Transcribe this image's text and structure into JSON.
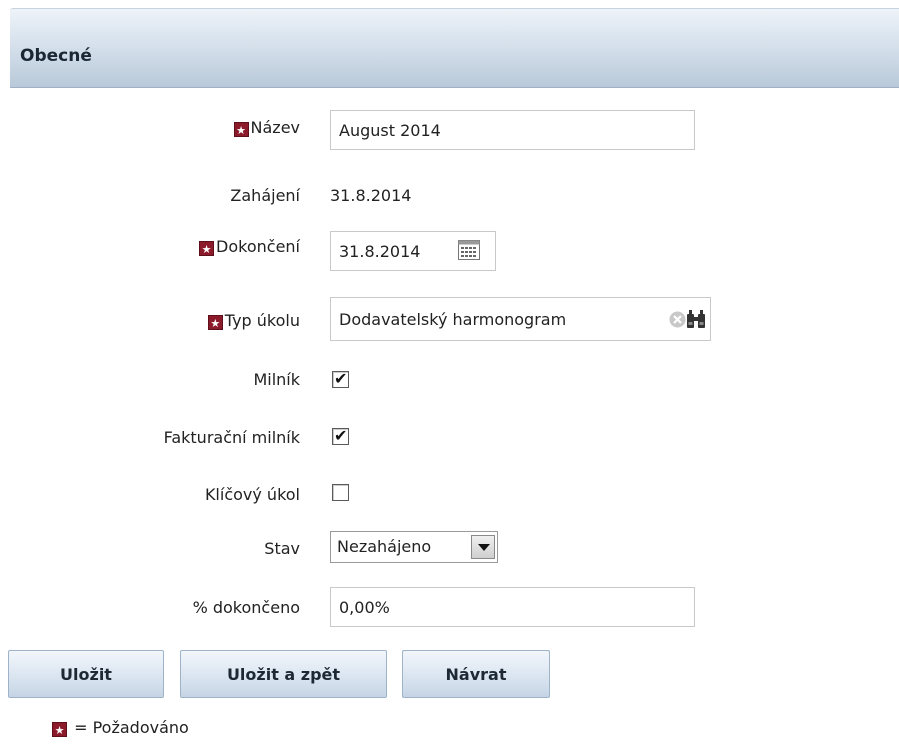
{
  "section": {
    "title": "Obecné"
  },
  "form": {
    "name_label": "Název",
    "name_value": "August 2014",
    "start_label": "Zahájení",
    "start_value": "31.8.2014",
    "end_label": "Dokončení",
    "end_value": "31.8.2014",
    "task_type_label": "Typ úkolu",
    "task_type_value": "Dodavatelský harmonogram",
    "milestone_label": "Milník",
    "milestone_checked": true,
    "billing_milestone_label": "Fakturační milník",
    "billing_milestone_checked": true,
    "key_task_label": "Klíčový úkol",
    "key_task_checked": false,
    "status_label": "Stav",
    "status_value": "Nezahájeno",
    "percent_label": "% dokončeno",
    "percent_value": "0,00%"
  },
  "buttons": {
    "save": "Uložit",
    "save_back": "Uložit a zpět",
    "return": "Návrat"
  },
  "legend": {
    "text": "= Požadováno"
  },
  "colors": {
    "required_marker": "#8b1a2b",
    "header_gradient_bottom": "#b9c9d9"
  }
}
